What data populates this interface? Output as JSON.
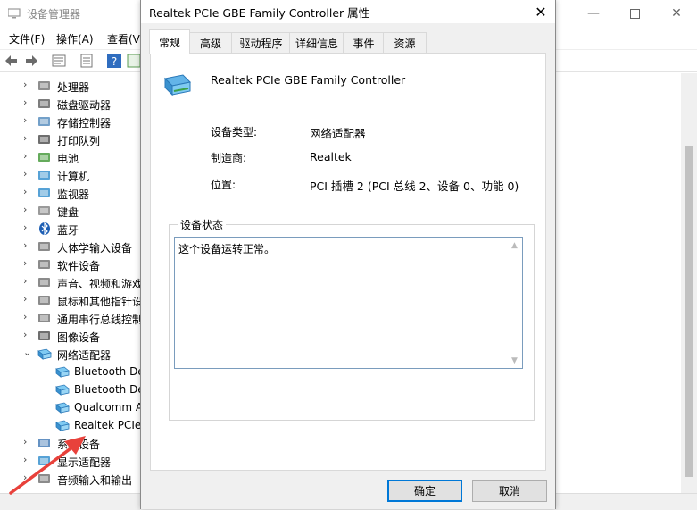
{
  "device_manager": {
    "title": "设备管理器",
    "menu": [
      "文件(F)",
      "操作(A)",
      "查看(V)"
    ],
    "tree": [
      {
        "label": "处理器",
        "icon": "processor-icon",
        "expand": "collapsed"
      },
      {
        "label": "磁盘驱动器",
        "icon": "disk-drive-icon",
        "expand": "collapsed"
      },
      {
        "label": "存储控制器",
        "icon": "storage-controller-icon",
        "expand": "collapsed"
      },
      {
        "label": "打印队列",
        "icon": "printer-icon",
        "expand": "collapsed"
      },
      {
        "label": "电池",
        "icon": "battery-icon",
        "expand": "collapsed"
      },
      {
        "label": "计算机",
        "icon": "computer-icon",
        "expand": "collapsed"
      },
      {
        "label": "监视器",
        "icon": "monitor-icon",
        "expand": "collapsed"
      },
      {
        "label": "键盘",
        "icon": "keyboard-icon",
        "expand": "collapsed"
      },
      {
        "label": "蓝牙",
        "icon": "bluetooth-icon",
        "expand": "collapsed"
      },
      {
        "label": "人体学输入设备",
        "icon": "hid-icon",
        "expand": "collapsed"
      },
      {
        "label": "软件设备",
        "icon": "software-device-icon",
        "expand": "collapsed"
      },
      {
        "label": "声音、视频和游戏",
        "icon": "sound-icon",
        "expand": "collapsed"
      },
      {
        "label": "鼠标和其他指针设",
        "icon": "mouse-icon",
        "expand": "collapsed"
      },
      {
        "label": "通用串行总线控制",
        "icon": "usb-icon",
        "expand": "collapsed"
      },
      {
        "label": "图像设备",
        "icon": "camera-icon",
        "expand": "collapsed"
      },
      {
        "label": "网络适配器",
        "icon": "network-adapter-icon",
        "expand": "expanded"
      },
      {
        "label": "Bluetooth De",
        "icon": "network-adapter-icon",
        "expand": "child"
      },
      {
        "label": "Bluetooth De",
        "icon": "network-adapter-icon",
        "expand": "child"
      },
      {
        "label": "Qualcomm A",
        "icon": "network-adapter-icon",
        "expand": "child"
      },
      {
        "label": "Realtek PCIe",
        "icon": "network-adapter-icon",
        "expand": "child"
      },
      {
        "label": "系统设备",
        "icon": "system-device-icon",
        "expand": "collapsed"
      },
      {
        "label": "显示适配器",
        "icon": "display-adapter-icon",
        "expand": "collapsed"
      },
      {
        "label": "音频输入和输出",
        "icon": "audio-io-icon",
        "expand": "collapsed"
      }
    ]
  },
  "dialog": {
    "title": "Realtek PCIe GBE Family Controller 属性",
    "tabs": [
      "常规",
      "高级",
      "驱动程序",
      "详细信息",
      "事件",
      "资源"
    ],
    "active_tab": "常规",
    "device_name": "Realtek PCIe GBE Family Controller",
    "properties": [
      {
        "key": "设备类型:",
        "value": "网络适配器"
      },
      {
        "key": "制造商:",
        "value": "Realtek"
      },
      {
        "key": "位置:",
        "value": "PCI 插槽 2 (PCI 总线 2、设备 0、功能 0)"
      }
    ],
    "status_group_label": "设备状态",
    "status_text": "这个设备运转正常。",
    "ok_label": "确定",
    "cancel_label": "取消"
  },
  "colors": {
    "accent": "#0078d7",
    "annotation_arrow": "#e8413b"
  }
}
